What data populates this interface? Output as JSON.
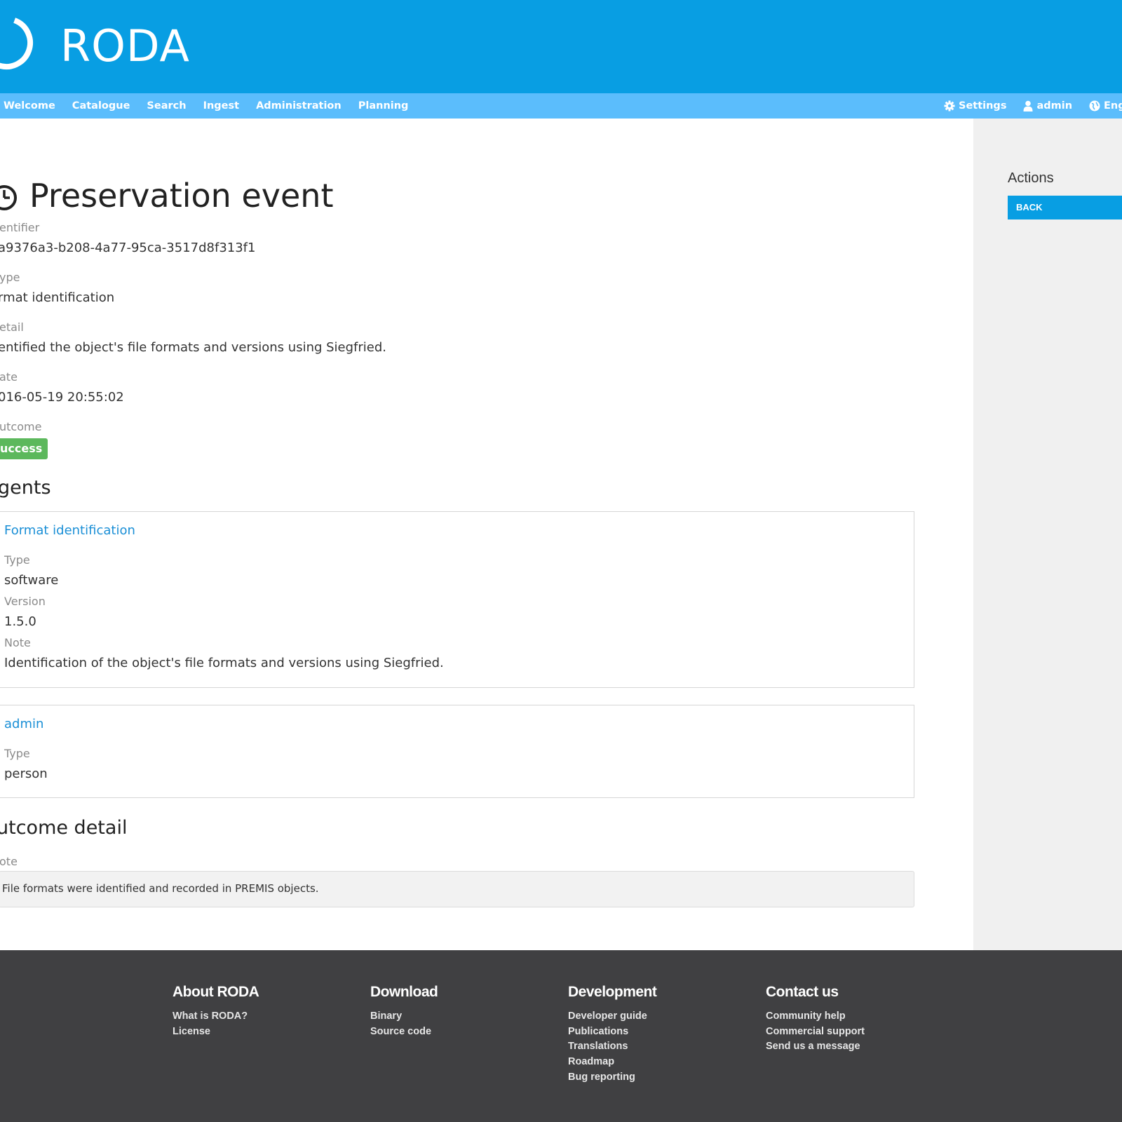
{
  "brand": {
    "name": "RODA"
  },
  "nav": {
    "items": [
      "Welcome",
      "Catalogue",
      "Search",
      "Ingest",
      "Administration",
      "Planning"
    ],
    "settings": "Settings",
    "user": "admin",
    "language": "Engli"
  },
  "page": {
    "title": "Preservation event",
    "identifier_label": "entifier",
    "identifier_value": "a9376a3-b208-4a77-95ca-3517d8f313f1",
    "type_label": "ype",
    "type_value": "rmat identification",
    "detail_label": "etail",
    "detail_value": "entified the object's file formats and versions using Siegfried.",
    "date_label": "ate",
    "date_value": "016-05-19 20:55:02",
    "outcome_label": "utcome",
    "outcome_value": "uccess"
  },
  "agents": {
    "title": "gents",
    "list": [
      {
        "name": "Format identification",
        "type_label": "Type",
        "type_value": "software",
        "version_label": "Version",
        "version_value": "1.5.0",
        "note_label": "Note",
        "note_value": "Identification of the object's file formats and versions using Siegfried."
      },
      {
        "name": "admin",
        "type_label": "Type",
        "type_value": "person"
      }
    ]
  },
  "outcome_detail": {
    "title": "utcome detail",
    "note_label": "ote",
    "note_value": "File formats were identified and recorded in PREMIS objects."
  },
  "sidebar": {
    "title": "Actions",
    "back_label": "BACK"
  },
  "footer": {
    "columns": [
      {
        "title": "About RODA",
        "links": [
          "What is RODA?",
          "License"
        ]
      },
      {
        "title": "Download",
        "links": [
          "Binary",
          "Source code"
        ]
      },
      {
        "title": "Development",
        "links": [
          "Developer guide",
          "Publications",
          "Translations",
          "Roadmap",
          "Bug reporting"
        ]
      },
      {
        "title": "Contact us",
        "links": [
          "Community help",
          "Commercial support",
          "Send us a message"
        ]
      }
    ]
  },
  "colors": {
    "header_bg": "#089ee3",
    "nav_bg": "#5bbdfc",
    "success": "#5cb85c",
    "link": "#1a8fd6",
    "footer_bg": "#404042"
  }
}
